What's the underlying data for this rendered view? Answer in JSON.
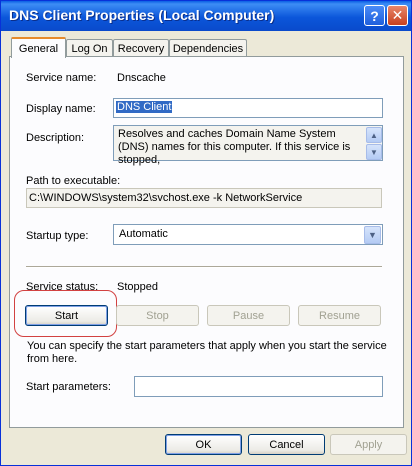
{
  "window": {
    "title": "DNS Client Properties (Local Computer)",
    "help_glyph": "?",
    "close_glyph": "✕"
  },
  "tabs": [
    {
      "label": "General",
      "active": true
    },
    {
      "label": "Log On",
      "active": false
    },
    {
      "label": "Recovery",
      "active": false
    },
    {
      "label": "Dependencies",
      "active": false
    }
  ],
  "general": {
    "service_name_label": "Service name:",
    "service_name_value": "Dnscache",
    "display_name_label": "Display name:",
    "display_name_value": "DNS Client",
    "description_label": "Description:",
    "description_value": "Resolves and caches Domain Name System (DNS) names for this computer. If this service is stopped,",
    "path_label": "Path to executable:",
    "path_value": "C:\\WINDOWS\\system32\\svchost.exe -k NetworkService",
    "startup_type_label": "Startup type:",
    "startup_type_value": "Automatic",
    "service_status_label": "Service status:",
    "service_status_value": "Stopped",
    "start_label": "Start",
    "stop_label": "Stop",
    "pause_label": "Pause",
    "resume_label": "Resume",
    "info_text": "You can specify the start parameters that apply when you start the service from here.",
    "start_params_label": "Start parameters:",
    "start_params_value": ""
  },
  "footer": {
    "ok_label": "OK",
    "cancel_label": "Cancel",
    "apply_label": "Apply"
  }
}
